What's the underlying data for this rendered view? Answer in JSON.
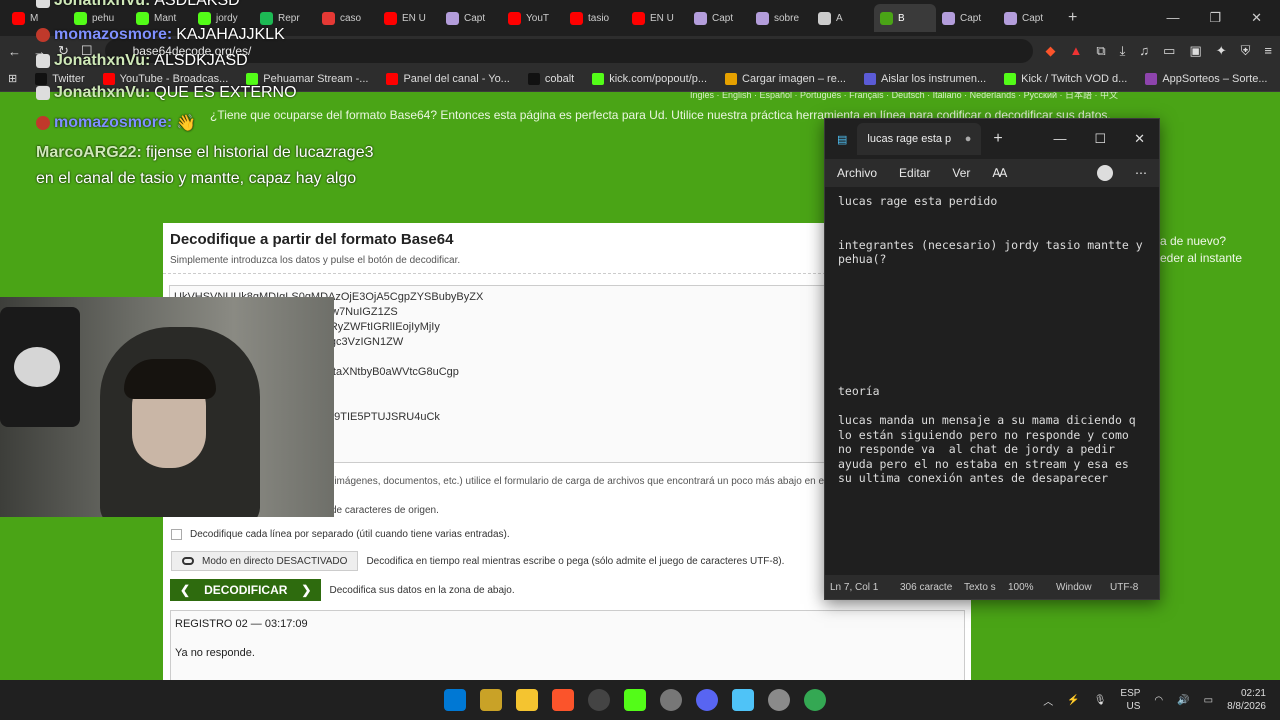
{
  "browser": {
    "tabs": [
      {
        "label": "M",
        "color": "#ff0000"
      },
      {
        "label": "pehu",
        "color": "#53fc18"
      },
      {
        "label": "Mant",
        "color": "#53fc18"
      },
      {
        "label": "jordy",
        "color": "#53fc18"
      },
      {
        "label": "Repr",
        "color": "#1db954"
      },
      {
        "label": "caso",
        "color": "#e53935"
      },
      {
        "label": "EN U",
        "color": "#ff0000"
      },
      {
        "label": "Capt",
        "color": "#b39ddb"
      },
      {
        "label": "YouT",
        "color": "#ff0000"
      },
      {
        "label": "tasio",
        "color": "#ff0000"
      },
      {
        "label": "EN U",
        "color": "#ff0000"
      },
      {
        "label": "Capt",
        "color": "#b39ddb"
      },
      {
        "label": "sobre",
        "color": "#b39ddb"
      },
      {
        "label": "A",
        "color": "#cccccc"
      },
      {
        "label": "B",
        "color": "#4aa416"
      },
      {
        "label": "Capt",
        "color": "#b39ddb"
      },
      {
        "label": "Capt",
        "color": "#b39ddb"
      }
    ],
    "url": "base64decode.org/es/",
    "bookmarks": [
      {
        "label": "Twitter",
        "color": "#111111"
      },
      {
        "label": "YouTube - Broadcas...",
        "color": "#ff0000"
      },
      {
        "label": "Pehuamar Stream -...",
        "color": "#53fc18"
      },
      {
        "label": "Panel del canal - Yo...",
        "color": "#ff0000"
      },
      {
        "label": "cobalt",
        "color": "#111111"
      },
      {
        "label": "kick.com/popout/p...",
        "color": "#53fc18"
      },
      {
        "label": "Cargar imagen – re...",
        "color": "#e6a100"
      },
      {
        "label": "Aislar los instrumen...",
        "color": "#5b5bd6"
      },
      {
        "label": "Kick / Twitch VOD d...",
        "color": "#53fc18"
      },
      {
        "label": "AppSorteos – Sorte...",
        "color": "#8e44ad"
      }
    ]
  },
  "site": {
    "toplinks": "Inglés · English · Español · Português · Français · Deutsch · Italiano · Nederlands · Русский · 日本語 · 中文",
    "headline": "¿Tiene que ocuparse del formato Base64? Entonces esta página es perfecta para Ud. Utilice nuestra práctica herramienta en línea para codificar o decodificar sus datos.",
    "side_text_1": "a de nuevo?",
    "side_text_2": "eder al instante",
    "title": "Decodifique a partir del formato Base64",
    "subtitle": "Simplemente introduzca los datos y pulse el botón de decodificar.",
    "input_text": "UkVHSVNUUk8gMDIgLS0gMDAzOjE3OjA5CgpZYSBubyByZX\n                              EgY29uZXhpw7NuIGZ1ZS\n                              SUgZWwgc3RyZWFtIGRlIEojIyMjIy\n                              wgdG9kYXMgc3VzIGN1ZW\n\n                              VRhcyBhbCBtaXNtbyB0aWVtcG8uCgp\n                              psd\n\n                              SCgoiTk8gTE9TIE5PTUJSRU4uCk\n                              Ulg==",
    "file_note": "(imágenes, documentos, etc.) utilice el formulario de carga de archivos que encontrará un poco más abajo en e",
    "charset_note": "de caracteres de origen.",
    "checkbox_label": "Decodifique cada línea por separado (útil cuando tiene varias entradas).",
    "live_button": "Modo en directo DESACTIVADO",
    "live_desc": "Decodifica en tiempo real mientras escribe o pega (sólo admite el juego de caracteres UTF-8).",
    "decode_button": "DECODIFICAR",
    "decode_desc": "Decodifica sus datos en la zona de abajo.",
    "output_line1": "REGISTRO 02 — 03:17:09",
    "output_line2": "Ya no responde."
  },
  "chat": [
    {
      "user": "JonathxnVu:",
      "msg": "ASDLAKSD",
      "color": "#cfe9b8"
    },
    {
      "user": "momazosmore:",
      "msg": "KAJAHAJJKLK",
      "color": "#7f90ff"
    },
    {
      "user": "JonathxnVu:",
      "msg": "ALSDKJASD",
      "color": "#cfe9b8"
    },
    {
      "user": "JonathxnVu:",
      "msg": "QUE ES EXTERNO",
      "color": "#cfe9b8"
    },
    {
      "user": "momazosmore:",
      "msg": "👋",
      "color": "#7f90ff"
    },
    {
      "user": "MarcoARG22:",
      "msg": "fijense el historial de lucazrage3",
      "color": "#cfe9b8"
    },
    {
      "user": "",
      "msg": "en el canal de tasio y mantte, capaz hay algo",
      "color": "#cfe9b8"
    }
  ],
  "notepad": {
    "tab_title": "lucas rage esta p",
    "menu": [
      "Archivo",
      "Editar",
      "Ver"
    ],
    "content": "lucas rage esta perdido\n\n\nintegrantes (necesario) jordy tasio mantte y pehua(?\n\n\n\n\n\n\n\n\nteoría\n\nlucas manda un mensaje a su mama diciendo q lo están siguiendo pero no responde y como no responde va  al chat de jordy a pedir ayuda pero el no estaba en stream y esa es su ultima conexión antes de desaparecer",
    "status": [
      "Ln 7, Col 1",
      "306 caracte",
      "Texto s",
      "100%",
      "Window",
      "UTF-8"
    ]
  },
  "taskbar": {
    "lang1": "ESP",
    "lang2": "US",
    "time": "02:21",
    "date": "8/8/2026"
  }
}
